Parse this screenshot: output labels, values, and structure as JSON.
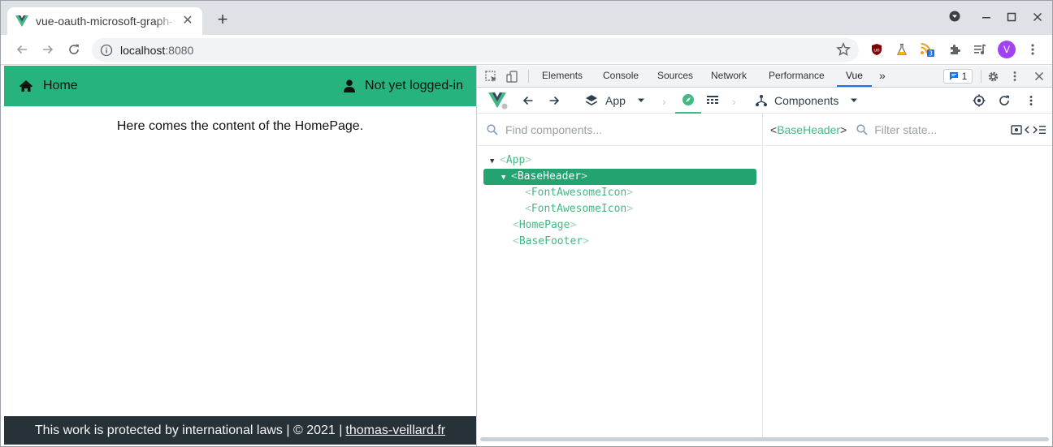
{
  "browser": {
    "tab_title": "vue-oauth-microsoft-graph-sample",
    "new_tab": "+",
    "url_host": "localhost",
    "url_port": ":8080",
    "avatar_letter": "V",
    "extension_badge": "3"
  },
  "app": {
    "header": {
      "home_label": "Home",
      "login_label": "Not yet logged-in"
    },
    "content_text": "Here comes the content of the HomePage.",
    "footer": {
      "text": "This work is protected by international laws | © 2021 |",
      "link_text": "thomas-veillard.fr"
    },
    "colors": {
      "header_bg": "#26b37e",
      "footer_bg": "#263238"
    }
  },
  "devtools": {
    "tabs": [
      "Elements",
      "Console",
      "Sources",
      "Network",
      "Performance",
      "Vue"
    ],
    "active_tab": "Vue",
    "more_tabs": "»",
    "issues_count": "1",
    "vue_bar": {
      "app_label": "App",
      "components_label": "Components"
    },
    "find_placeholder": "Find components...",
    "filter_placeholder": "Filter state...",
    "selected_component": "BaseHeader",
    "tree": [
      {
        "name": "App",
        "caret": "▼"
      },
      {
        "name": "BaseHeader",
        "caret": "▼",
        "selected": true
      },
      {
        "name": "FontAwesomeIcon",
        "caret": ""
      },
      {
        "name": "FontAwesomeIcon",
        "caret": ""
      },
      {
        "name": "HomePage",
        "caret": ""
      },
      {
        "name": "BaseFooter",
        "caret": ""
      }
    ]
  }
}
